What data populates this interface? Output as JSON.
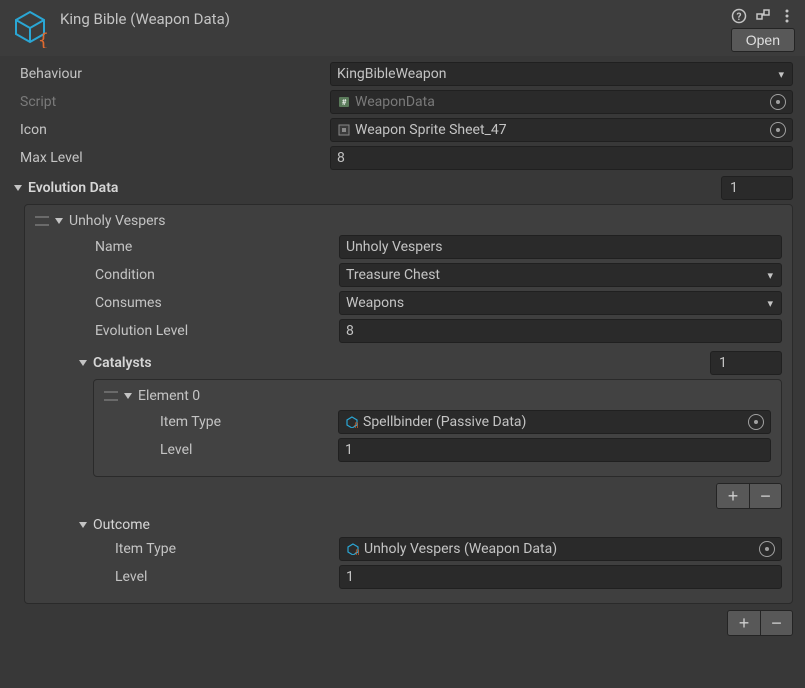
{
  "header": {
    "title": "King Bible (Weapon Data)",
    "open_label": "Open"
  },
  "fields": {
    "behaviour_label": "Behaviour",
    "behaviour_value": "KingBibleWeapon",
    "script_label": "Script",
    "script_value": "WeaponData",
    "icon_label": "Icon",
    "icon_value": "Weapon Sprite Sheet_47",
    "maxlevel_label": "Max Level",
    "maxlevel_value": "8"
  },
  "evolution": {
    "title": "Evolution Data",
    "count": "1",
    "item0": {
      "heading": "Unholy Vespers",
      "name_label": "Name",
      "name_value": "Unholy Vespers",
      "condition_label": "Condition",
      "condition_value": "Treasure Chest",
      "consumes_label": "Consumes",
      "consumes_value": "Weapons",
      "evo_level_label": "Evolution Level",
      "evo_level_value": "8",
      "catalysts": {
        "title": "Catalysts",
        "count": "1",
        "element0": {
          "heading": "Element 0",
          "itemtype_label": "Item Type",
          "itemtype_value": "Spellbinder (Passive Data)",
          "level_label": "Level",
          "level_value": "1"
        }
      },
      "outcome": {
        "title": "Outcome",
        "itemtype_label": "Item Type",
        "itemtype_value": "Unholy Vespers (Weapon Data)",
        "level_label": "Level",
        "level_value": "1"
      }
    }
  }
}
